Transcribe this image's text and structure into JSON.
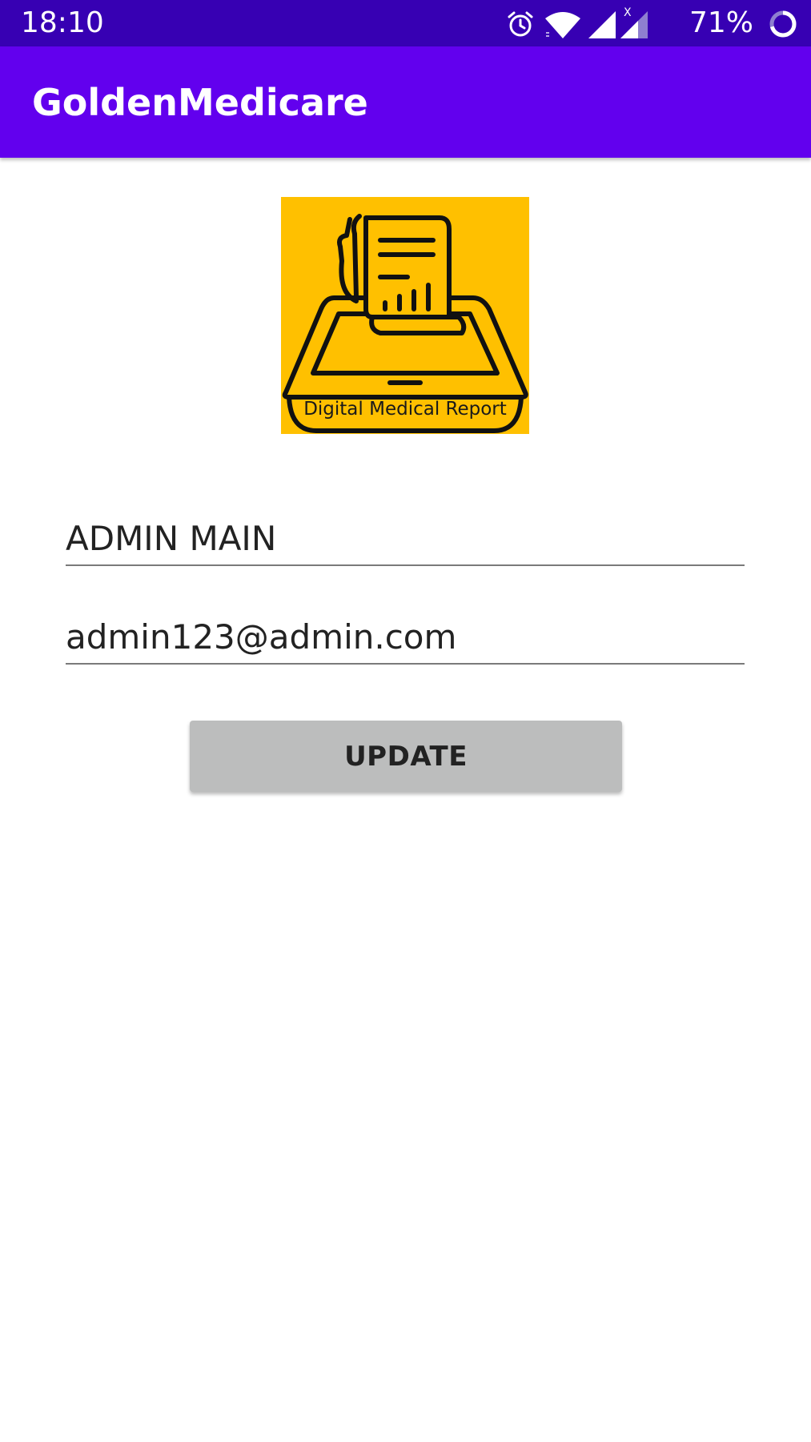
{
  "status_bar": {
    "time": "18:10",
    "battery_percent": "71%",
    "icons": [
      "alarm-icon",
      "wifi-icon",
      "signal-icon",
      "signal-no-data-icon",
      "battery-ring-icon"
    ],
    "battery_level": 0.71,
    "background": "#3700b3"
  },
  "app_bar": {
    "title": "GoldenMedicare",
    "background": "#6200ee"
  },
  "logo": {
    "caption": "Digital Medical Report",
    "background": "#ffc000",
    "icon": "medical-report-tablet-icon"
  },
  "form": {
    "name_value": "ADMIN MAIN",
    "email_value": "admin123@admin.com",
    "update_label": "UPDATE",
    "button_color": "#bcbdbd"
  }
}
